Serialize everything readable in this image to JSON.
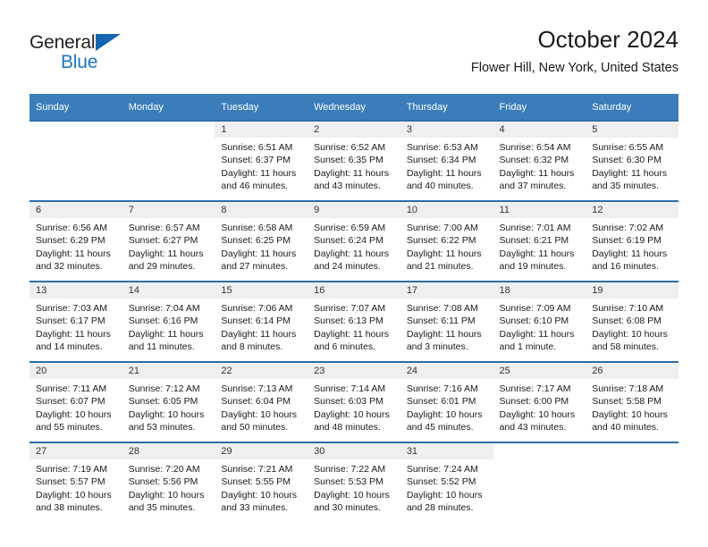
{
  "brand": {
    "name_dark": "General",
    "name_blue": "Blue",
    "dark_color": "#231f20",
    "blue_color": "#1b76c4"
  },
  "header": {
    "title": "October 2024",
    "subtitle": "Flower Hill, New York, United States"
  },
  "theme": {
    "header_band": "#3b7dba",
    "row_rule": "#2e6da4",
    "daynum_band": "#efefef",
    "text": "#1a1a1a"
  },
  "weekday_headers": [
    "Sunday",
    "Monday",
    "Tuesday",
    "Wednesday",
    "Thursday",
    "Friday",
    "Saturday"
  ],
  "labels": {
    "sunrise_prefix": "Sunrise:",
    "sunset_prefix": "Sunset:",
    "daylight_prefix": "Daylight:"
  },
  "weeks": [
    [
      {
        "day": "",
        "line1": "",
        "line2": "",
        "line3": "",
        "line4": "",
        "blank": true
      },
      {
        "day": "",
        "line1": "",
        "line2": "",
        "line3": "",
        "line4": "",
        "blank": true
      },
      {
        "day": "1",
        "line1": "Sunrise: 6:51 AM",
        "line2": "Sunset: 6:37 PM",
        "line3": "Daylight: 11 hours",
        "line4": "and 46 minutes."
      },
      {
        "day": "2",
        "line1": "Sunrise: 6:52 AM",
        "line2": "Sunset: 6:35 PM",
        "line3": "Daylight: 11 hours",
        "line4": "and 43 minutes."
      },
      {
        "day": "3",
        "line1": "Sunrise: 6:53 AM",
        "line2": "Sunset: 6:34 PM",
        "line3": "Daylight: 11 hours",
        "line4": "and 40 minutes."
      },
      {
        "day": "4",
        "line1": "Sunrise: 6:54 AM",
        "line2": "Sunset: 6:32 PM",
        "line3": "Daylight: 11 hours",
        "line4": "and 37 minutes."
      },
      {
        "day": "5",
        "line1": "Sunrise: 6:55 AM",
        "line2": "Sunset: 6:30 PM",
        "line3": "Daylight: 11 hours",
        "line4": "and 35 minutes."
      }
    ],
    [
      {
        "day": "6",
        "line1": "Sunrise: 6:56 AM",
        "line2": "Sunset: 6:29 PM",
        "line3": "Daylight: 11 hours",
        "line4": "and 32 minutes."
      },
      {
        "day": "7",
        "line1": "Sunrise: 6:57 AM",
        "line2": "Sunset: 6:27 PM",
        "line3": "Daylight: 11 hours",
        "line4": "and 29 minutes."
      },
      {
        "day": "8",
        "line1": "Sunrise: 6:58 AM",
        "line2": "Sunset: 6:25 PM",
        "line3": "Daylight: 11 hours",
        "line4": "and 27 minutes."
      },
      {
        "day": "9",
        "line1": "Sunrise: 6:59 AM",
        "line2": "Sunset: 6:24 PM",
        "line3": "Daylight: 11 hours",
        "line4": "and 24 minutes."
      },
      {
        "day": "10",
        "line1": "Sunrise: 7:00 AM",
        "line2": "Sunset: 6:22 PM",
        "line3": "Daylight: 11 hours",
        "line4": "and 21 minutes."
      },
      {
        "day": "11",
        "line1": "Sunrise: 7:01 AM",
        "line2": "Sunset: 6:21 PM",
        "line3": "Daylight: 11 hours",
        "line4": "and 19 minutes."
      },
      {
        "day": "12",
        "line1": "Sunrise: 7:02 AM",
        "line2": "Sunset: 6:19 PM",
        "line3": "Daylight: 11 hours",
        "line4": "and 16 minutes."
      }
    ],
    [
      {
        "day": "13",
        "line1": "Sunrise: 7:03 AM",
        "line2": "Sunset: 6:17 PM",
        "line3": "Daylight: 11 hours",
        "line4": "and 14 minutes."
      },
      {
        "day": "14",
        "line1": "Sunrise: 7:04 AM",
        "line2": "Sunset: 6:16 PM",
        "line3": "Daylight: 11 hours",
        "line4": "and 11 minutes."
      },
      {
        "day": "15",
        "line1": "Sunrise: 7:06 AM",
        "line2": "Sunset: 6:14 PM",
        "line3": "Daylight: 11 hours",
        "line4": "and 8 minutes."
      },
      {
        "day": "16",
        "line1": "Sunrise: 7:07 AM",
        "line2": "Sunset: 6:13 PM",
        "line3": "Daylight: 11 hours",
        "line4": "and 6 minutes."
      },
      {
        "day": "17",
        "line1": "Sunrise: 7:08 AM",
        "line2": "Sunset: 6:11 PM",
        "line3": "Daylight: 11 hours",
        "line4": "and 3 minutes."
      },
      {
        "day": "18",
        "line1": "Sunrise: 7:09 AM",
        "line2": "Sunset: 6:10 PM",
        "line3": "Daylight: 11 hours",
        "line4": "and 1 minute."
      },
      {
        "day": "19",
        "line1": "Sunrise: 7:10 AM",
        "line2": "Sunset: 6:08 PM",
        "line3": "Daylight: 10 hours",
        "line4": "and 58 minutes."
      }
    ],
    [
      {
        "day": "20",
        "line1": "Sunrise: 7:11 AM",
        "line2": "Sunset: 6:07 PM",
        "line3": "Daylight: 10 hours",
        "line4": "and 55 minutes."
      },
      {
        "day": "21",
        "line1": "Sunrise: 7:12 AM",
        "line2": "Sunset: 6:05 PM",
        "line3": "Daylight: 10 hours",
        "line4": "and 53 minutes."
      },
      {
        "day": "22",
        "line1": "Sunrise: 7:13 AM",
        "line2": "Sunset: 6:04 PM",
        "line3": "Daylight: 10 hours",
        "line4": "and 50 minutes."
      },
      {
        "day": "23",
        "line1": "Sunrise: 7:14 AM",
        "line2": "Sunset: 6:03 PM",
        "line3": "Daylight: 10 hours",
        "line4": "and 48 minutes."
      },
      {
        "day": "24",
        "line1": "Sunrise: 7:16 AM",
        "line2": "Sunset: 6:01 PM",
        "line3": "Daylight: 10 hours",
        "line4": "and 45 minutes."
      },
      {
        "day": "25",
        "line1": "Sunrise: 7:17 AM",
        "line2": "Sunset: 6:00 PM",
        "line3": "Daylight: 10 hours",
        "line4": "and 43 minutes."
      },
      {
        "day": "26",
        "line1": "Sunrise: 7:18 AM",
        "line2": "Sunset: 5:58 PM",
        "line3": "Daylight: 10 hours",
        "line4": "and 40 minutes."
      }
    ],
    [
      {
        "day": "27",
        "line1": "Sunrise: 7:19 AM",
        "line2": "Sunset: 5:57 PM",
        "line3": "Daylight: 10 hours",
        "line4": "and 38 minutes."
      },
      {
        "day": "28",
        "line1": "Sunrise: 7:20 AM",
        "line2": "Sunset: 5:56 PM",
        "line3": "Daylight: 10 hours",
        "line4": "and 35 minutes."
      },
      {
        "day": "29",
        "line1": "Sunrise: 7:21 AM",
        "line2": "Sunset: 5:55 PM",
        "line3": "Daylight: 10 hours",
        "line4": "and 33 minutes."
      },
      {
        "day": "30",
        "line1": "Sunrise: 7:22 AM",
        "line2": "Sunset: 5:53 PM",
        "line3": "Daylight: 10 hours",
        "line4": "and 30 minutes."
      },
      {
        "day": "31",
        "line1": "Sunrise: 7:24 AM",
        "line2": "Sunset: 5:52 PM",
        "line3": "Daylight: 10 hours",
        "line4": "and 28 minutes."
      },
      {
        "day": "",
        "line1": "",
        "line2": "",
        "line3": "",
        "line4": "",
        "blank": true
      },
      {
        "day": "",
        "line1": "",
        "line2": "",
        "line3": "",
        "line4": "",
        "blank": true
      }
    ]
  ]
}
